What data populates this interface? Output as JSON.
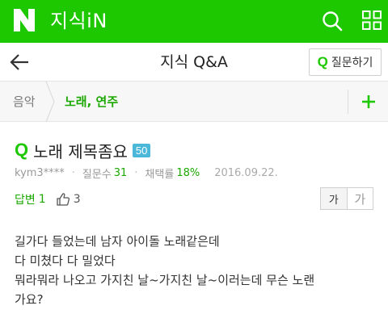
{
  "header": {
    "logo_letter": "N",
    "brand": "지식iN",
    "colors": {
      "brand_green": "#1ec800",
      "text_green": "#1ba800",
      "badge_blue": "#4bb8d9"
    }
  },
  "subheader": {
    "title": "지식 Q&A",
    "ask_button": {
      "icon": "Q",
      "label": "질문하기"
    }
  },
  "breadcrumb": {
    "parent": "음악",
    "current": "노래, 연주"
  },
  "question": {
    "icon": "Q",
    "title": "노래 제목좀요",
    "badge": "50",
    "author": "kym3****",
    "question_count_label": "질문수",
    "question_count": "31",
    "adopt_rate_label": "채택률",
    "adopt_rate": "18%",
    "date": "2016.09.22.",
    "answers_label": "답변",
    "answers_count": "1",
    "likes": "3",
    "font_small": "가",
    "font_large": "가",
    "body_lines": [
      "길가다 들었는데 남자 아이돌 노래같은데",
      "다 미쳤다 다 밀었다",
      "뭐라뭐라 나오고 가지친 날~가지친 날~이러는데 무슨 노랜",
      "가요?"
    ]
  },
  "icons": {
    "search": "search-icon",
    "grid": "grid-menu-icon",
    "back": "back-arrow-icon",
    "chevron": "chevron-right-icon",
    "plus": "plus-icon",
    "like": "thumbs-up-icon"
  }
}
